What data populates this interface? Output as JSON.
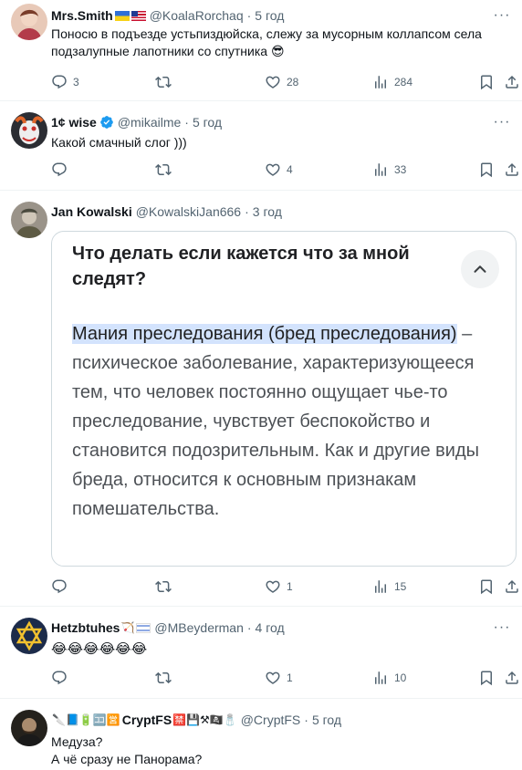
{
  "tweets": [
    {
      "name": "Mrs.Smith",
      "handle": "@KoalaRorchaq",
      "time": "5 год",
      "text_lines": [
        "Поносю в подъезде устьпиздюйска, слежу за мусорным коллапсом села",
        "подзалупные лапотники со спутника 😎"
      ],
      "stats": {
        "replies": "3",
        "retweets": "",
        "likes": "28",
        "views": "284"
      }
    },
    {
      "name": "1¢ wise",
      "handle": "@mikailme",
      "time": "5 год",
      "text_lines": [
        "Какой смачный слог )))"
      ],
      "stats": {
        "replies": "",
        "retweets": "",
        "likes": "4",
        "views": "33"
      }
    },
    {
      "name": "Jan Kowalski",
      "handle": "@KowalskiJan666",
      "time": "3 год",
      "card": {
        "question": "Что делать если кажется что за мной следят?",
        "highlight": "Мания преследования (бред преследования)",
        "answer": " – психическое заболевание, характеризующееся тем, что человек постоянно ощущает чье-то преследование, чувствует беспокойство и становится подозрительным. Как и другие виды бреда, относится к основным признакам помешательства."
      },
      "stats": {
        "replies": "",
        "retweets": "",
        "likes": "1",
        "views": "15"
      }
    },
    {
      "name": "Hetzbtuhes",
      "name_emoji": "🏹",
      "handle": "@MBeyderman",
      "time": "4 год",
      "text_lines": [
        "😂😂😂😂😂😂"
      ],
      "stats": {
        "replies": "",
        "retweets": "",
        "likes": "1",
        "views": "10"
      }
    },
    {
      "name": "CryptFS",
      "name_prefix": "🔪📘🔋🈁🈺",
      "name_suffix": "🈲💾⚒🏴‍☠️🧂",
      "handle": "@CryptFS",
      "time": "5 год",
      "text_lines": [
        "Медуза?",
        "А чё сразу не Панорама?"
      ]
    }
  ],
  "separator_dot": "·",
  "icons": [
    "reply-icon",
    "retweet-icon",
    "like-icon",
    "views-icon",
    "bookmark-icon",
    "share-icon",
    "more-icon",
    "verified-icon",
    "chevron-up-icon"
  ],
  "colors": {
    "text": "#0f1419",
    "secondary": "#536471",
    "verified": "#1d9bf0",
    "divider": "#eff3f4",
    "highlight": "#d3e3fd"
  }
}
